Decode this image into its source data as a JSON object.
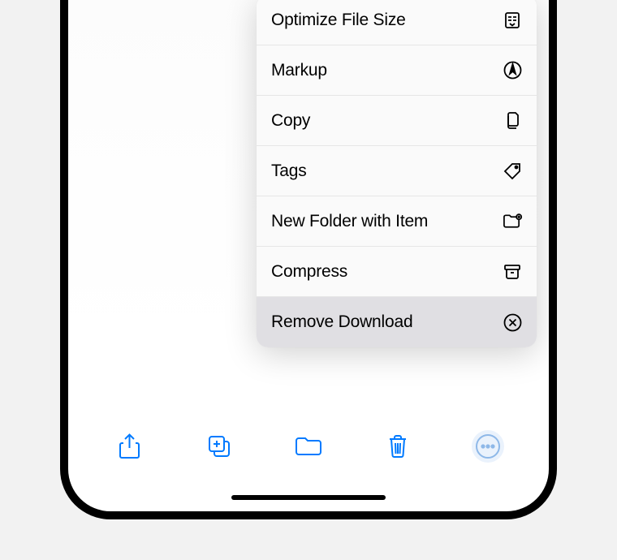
{
  "menu": {
    "items": [
      {
        "label": "Optimize File Size",
        "icon": "file-reduce"
      },
      {
        "label": "Markup",
        "icon": "markup"
      },
      {
        "label": "Copy",
        "icon": "copy"
      },
      {
        "label": "Tags",
        "icon": "tag"
      },
      {
        "label": "New Folder with Item",
        "icon": "folder-plus"
      },
      {
        "label": "Compress",
        "icon": "archive"
      },
      {
        "label": "Remove Download",
        "icon": "remove"
      }
    ]
  },
  "toolbar": {
    "buttons": [
      {
        "name": "share",
        "icon": "share"
      },
      {
        "name": "duplicate",
        "icon": "duplicate"
      },
      {
        "name": "move",
        "icon": "folder"
      },
      {
        "name": "delete",
        "icon": "trash"
      },
      {
        "name": "more",
        "icon": "more"
      }
    ]
  }
}
